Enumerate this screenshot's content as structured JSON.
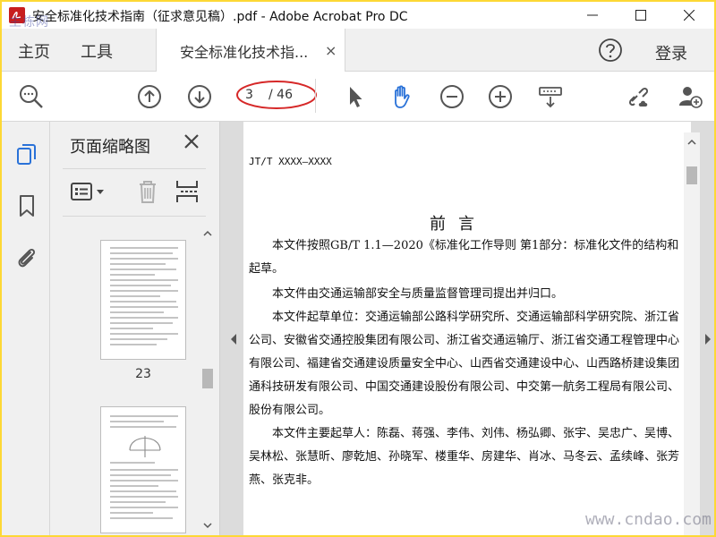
{
  "window": {
    "title": "安全标准化技术指南（征求意见稿）.pdf - Adobe Acrobat Pro DC",
    "watermark_corner": "主栋网"
  },
  "menubar": {
    "home": "主页",
    "tools": "工具",
    "tab_label": "安全标准化技术指...",
    "tab_close": "×",
    "login": "登录"
  },
  "toolbar": {
    "page_current": "3",
    "page_total": "/ 46"
  },
  "panel": {
    "title": "页面缩略图",
    "thumbs": [
      {
        "label": "23"
      }
    ]
  },
  "document": {
    "doc_id": "JT/T XXXX—XXXX",
    "heading": "前言",
    "paragraphs": [
      "本文件按照GB/T 1.1—2020《标准化工作导则 第1部分：标准化文件的结构和起草。",
      "本文件由交通运输部安全与质量监督管理司提出并归口。",
      "本文件起草单位：交通运输部公路科学研究所、交通运输部科学研究院、浙江省公司、安徽省交通控股集团有限公司、浙江省交通运输厅、浙江省交通工程管理中心有限公司、福建省交通建设质量安全中心、山西省交通建设中心、山西路桥建设集团通科技研发有限公司、中国交通建设股份有限公司、中交第一航务工程局有限公司、股份有限公司。",
      "本文件主要起草人：陈磊、蒋强、李伟、刘伟、杨弘卿、张宇、吴忠广、吴博、吴林松、张慧昕、廖乾旭、孙晓军、楼重华、房建华、肖冰、马冬云、孟续峰、张芳燕、张克非。"
    ],
    "watermark": "www.cndao.com"
  },
  "colors": {
    "accent": "#2a72d8",
    "annotation_ring": "#d62828",
    "frame": "#fdd835"
  }
}
